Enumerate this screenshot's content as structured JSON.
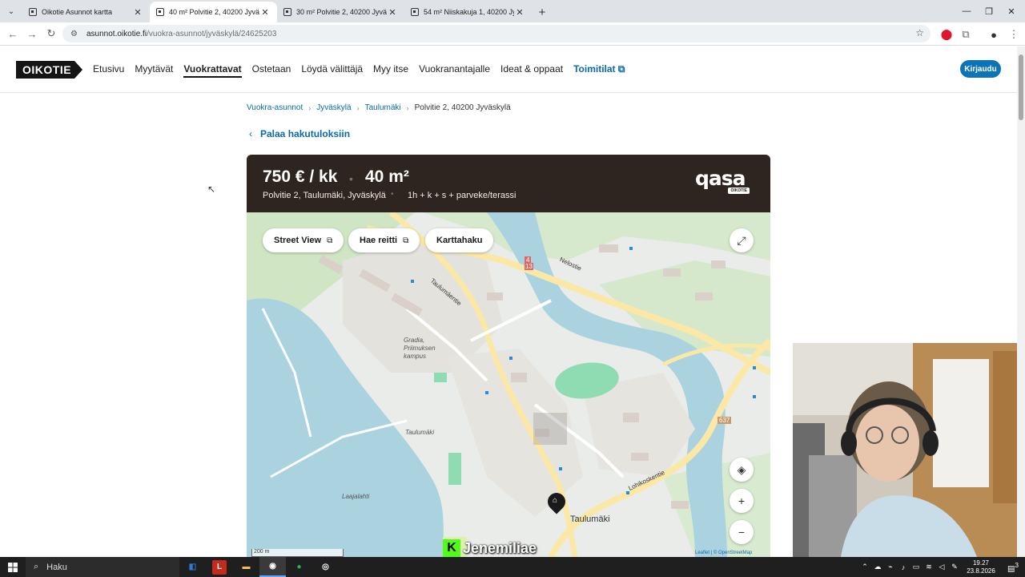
{
  "browser": {
    "tabs": [
      {
        "title": "Oikotie Asunnot kartta",
        "active": false
      },
      {
        "title": "40 m² Polvitie 2, 40200 Jyväskylä",
        "active": true
      },
      {
        "title": "30 m² Polvitie 2, 40200 Jyväskylä",
        "active": false
      },
      {
        "title": "54 m² Niiskakuja 1, 40200 Jyväskylä",
        "active": false
      }
    ],
    "url_host": "asunnot.oikotie.fi",
    "url_path": "/vuokra-asunnot/jyväskylä/24625203"
  },
  "site": {
    "logo": "OIKOTIE",
    "nav": [
      {
        "label": "Etusivu"
      },
      {
        "label": "Myytävät"
      },
      {
        "label": "Vuokrattavat",
        "active": true
      },
      {
        "label": "Ostetaan"
      },
      {
        "label": "Löydä välittäjä"
      },
      {
        "label": "Myy itse"
      },
      {
        "label": "Vuokranantajalle"
      },
      {
        "label": "Ideat & oppaat"
      },
      {
        "label": "Toimitilat",
        "accent": true
      }
    ],
    "login_label": "Kirjaudu"
  },
  "breadcrumb": [
    "Vuokra-asunnot",
    "Jyväskylä",
    "Taulumäki",
    "Polvitie 2, 40200 Jyväskylä"
  ],
  "back_label": "Palaa hakutuloksiin",
  "listing": {
    "price": "750 € / kk",
    "area": "40 m²",
    "address": "Polvitie 2, Taulumäki, Jyväskylä",
    "rooms": "1h + k + s + parveke/terassi",
    "brand": "qasa",
    "brand_tag": "OIKOTIE"
  },
  "map": {
    "buttons": {
      "street_view": "Street View",
      "route": "Hae reitti",
      "map_search": "Karttahaku"
    },
    "labels": {
      "gradia": "Gradia, Priimuksen kampus",
      "taulumaki": "Taulumäki",
      "laajalahti": "Laajalahti",
      "nelostie": "Nelostie",
      "taulumaentie": "Taulumäentie",
      "lohikoskentie": "Lohikoskentie",
      "taulumaki_small": "Taulumäki",
      "road_4": "4",
      "road_13": "13",
      "road_637": "637",
      "scale": "200 m",
      "attribution": "Leaflet | © OpenStreetMap"
    },
    "zoom_in": "+",
    "zoom_out": "−"
  },
  "overlay_name": "Jenemiliae",
  "taskbar": {
    "search_label": "Haku",
    "time": "19.27",
    "date": "23.8.2026",
    "notifications": "3"
  }
}
